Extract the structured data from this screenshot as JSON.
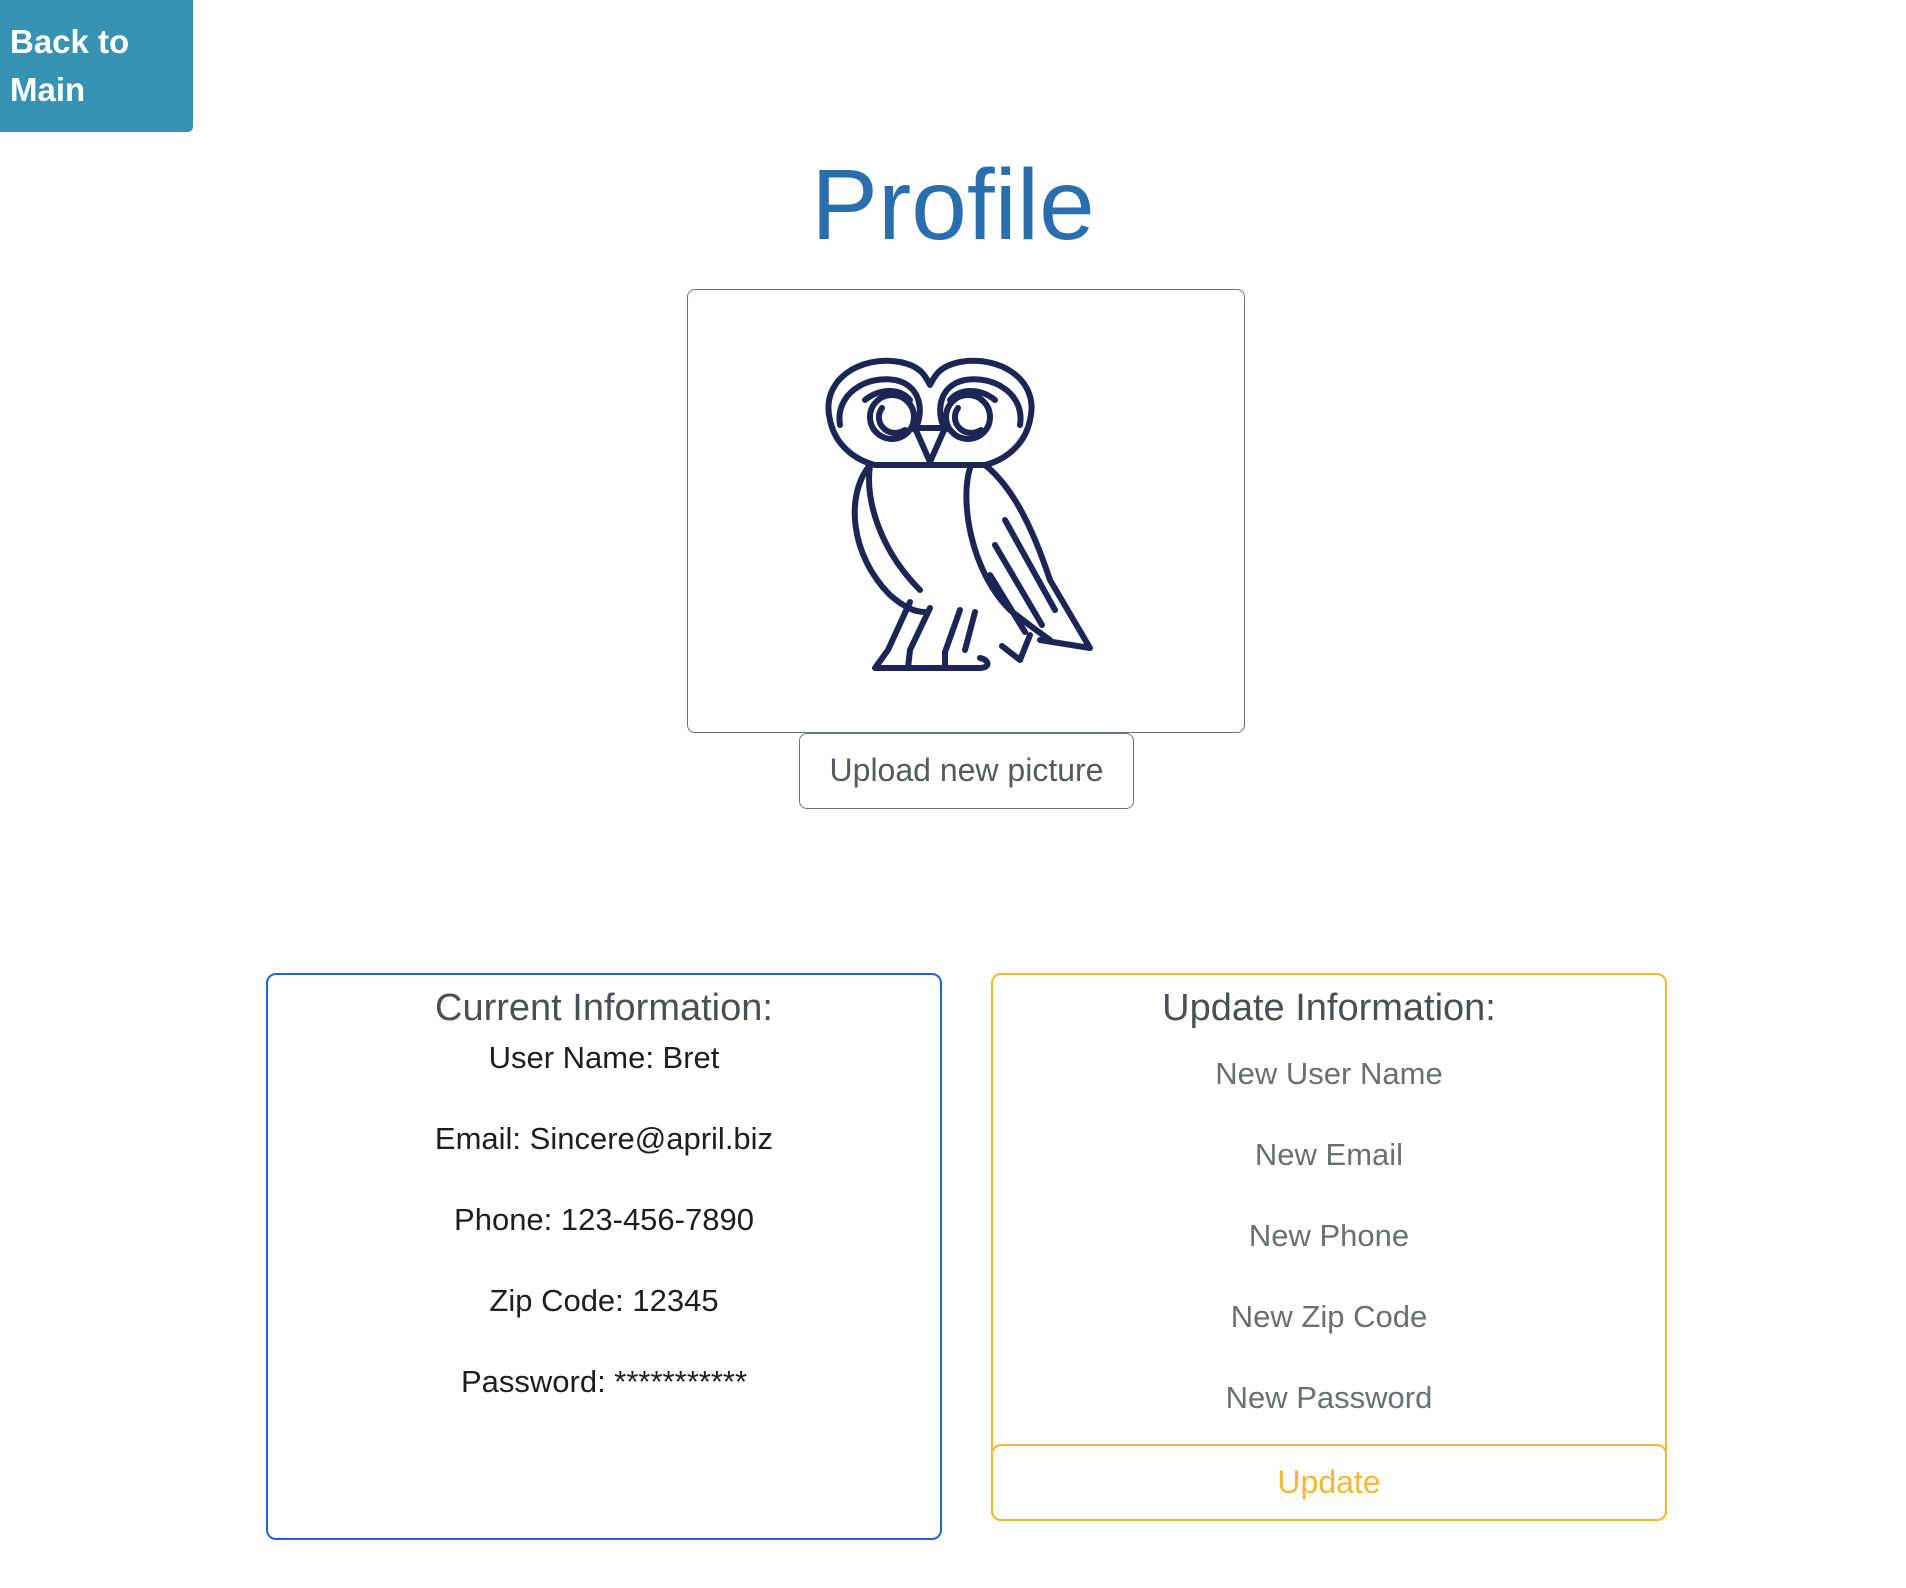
{
  "nav": {
    "back_label_line1": "Back to",
    "back_label_line2": "Main"
  },
  "page": {
    "title": "Profile"
  },
  "picture": {
    "icon": "owl-logo",
    "upload_label": "Upload new picture"
  },
  "current": {
    "title": "Current Information:",
    "username": "User Name: Bret",
    "email": "Email: Sincere@april.biz",
    "phone": "Phone: 123-456-7890",
    "zip": "Zip Code: 12345",
    "password": "Password: ***********"
  },
  "update": {
    "title": "Update Information:",
    "username_placeholder": "New User Name",
    "email_placeholder": "New Email",
    "phone_placeholder": "New Phone",
    "zip_placeholder": "New Zip Code",
    "password_placeholder": "New Password",
    "button_label": "Update"
  },
  "colors": {
    "back_button": "#3793b1",
    "title": "#2a6ead",
    "current_border": "#2065d4",
    "update_border": "#f5b931",
    "owl_stroke": "#1b2654"
  }
}
